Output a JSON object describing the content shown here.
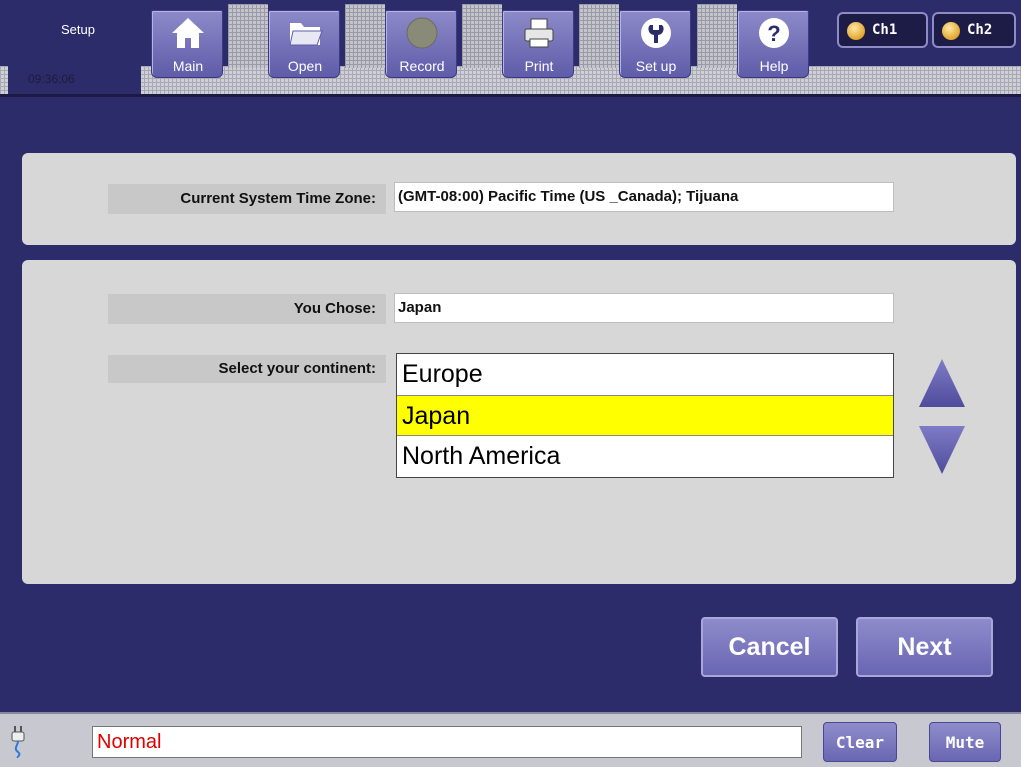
{
  "header": {
    "screen_title": "Setup",
    "clock": "09:36:06",
    "toolbar": [
      {
        "id": "main",
        "label": "Main",
        "icon": "home-icon"
      },
      {
        "id": "open",
        "label": "Open",
        "icon": "folder-icon"
      },
      {
        "id": "record",
        "label": "Record",
        "icon": "record-icon"
      },
      {
        "id": "print",
        "label": "Print",
        "icon": "printer-icon"
      },
      {
        "id": "setup",
        "label": "Set up",
        "icon": "wrench-icon"
      },
      {
        "id": "help",
        "label": "Help",
        "icon": "help-icon"
      }
    ],
    "channels": [
      {
        "label": "Ch1"
      },
      {
        "label": "Ch2"
      }
    ]
  },
  "timezone": {
    "label": "Current System Time Zone:",
    "value": "(GMT-08:00) Pacific Time (US _Canada); Tijuana"
  },
  "selection": {
    "chose_label": "You Chose:",
    "chose_value": "Japan",
    "continent_label": "Select your continent:",
    "options": [
      "Europe",
      "Japan",
      "North America"
    ],
    "selected": "Japan"
  },
  "actions": {
    "cancel": "Cancel",
    "next": "Next"
  },
  "status": {
    "message": "Normal",
    "clear": "Clear",
    "mute": "Mute"
  },
  "colors": {
    "background": "#2d2c6b",
    "button": "#7a77bd",
    "selected_row": "#ffff00",
    "status_text": "#e00000",
    "channel_dot": "#e8b13a"
  }
}
